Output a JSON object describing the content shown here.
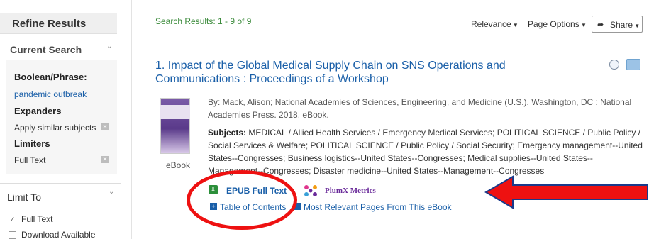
{
  "sidebar": {
    "refine_title": "Refine Results",
    "current_search_title": "Current Search",
    "boolean_label": "Boolean/Phrase:",
    "boolean_value": "pandemic outbreak",
    "expanders_label": "Expanders",
    "expander_item": "Apply similar subjects",
    "limiters_label": "Limiters",
    "limiter_item": "Full Text",
    "limit_to_title": "Limit To",
    "limit_options": [
      {
        "label": "Full Text",
        "checked": true
      },
      {
        "label": "Download Available",
        "checked": false
      }
    ]
  },
  "toolbar": {
    "results_count": "Search Results: 1 - 9 of 9",
    "sort_label": "Relevance",
    "page_options_label": "Page Options",
    "share_label": "Share"
  },
  "result": {
    "number": "1.",
    "title": "Impact of the Global Medical Supply Chain on SNS Operations and Communications : Proceedings of a Workshop",
    "byline": "By: Mack, Alison; National Academies of Sciences, Engineering, and Medicine (U.S.). Washington, DC : National Academies Press. 2018. eBook.",
    "subjects_label": "Subjects:",
    "subjects": "MEDICAL / Allied Health Services / Emergency Medical Services; POLITICAL SCIENCE / Public Policy / Social Services & Welfare; POLITICAL SCIENCE / Public Policy / Social Security; Emergency management--United States--Congresses; Business logistics--United States--Congresses; Medical supplies--United States--Management--Congresses; Disaster medicine--United States--Management--Congresses",
    "format_label": "eBook",
    "epub_label": "EPUB Full Text",
    "plumx_label": "PlumX Metrics",
    "toc_label": "Table of Contents",
    "relevant_pages_label": "Most Relevant Pages From This eBook"
  },
  "colors": {
    "link": "#1a5fa8",
    "results_green": "#3a8a3a",
    "annotation_red": "#ee1111"
  }
}
